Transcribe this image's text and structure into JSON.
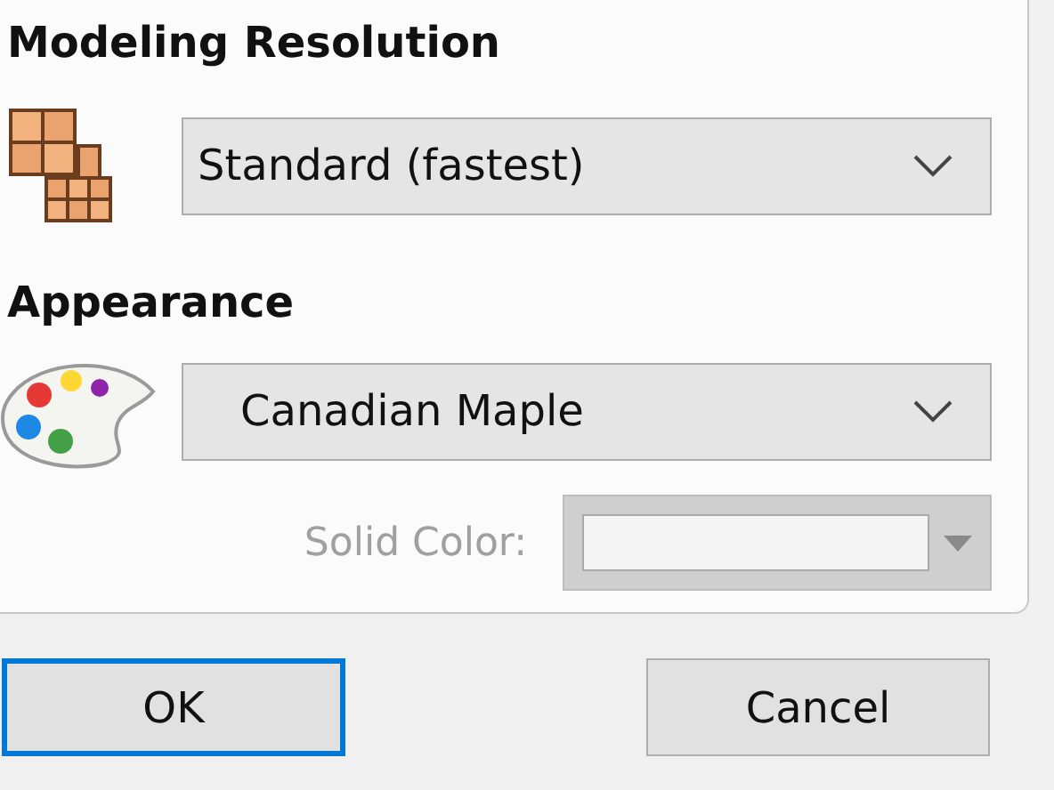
{
  "modeling_resolution": {
    "label": "Modeling Resolution",
    "value": "Standard (fastest)"
  },
  "appearance": {
    "label": "Appearance",
    "value": "Canadian Maple",
    "solid_color": {
      "label": "Solid Color:",
      "disabled": true
    }
  },
  "buttons": [
    {
      "label": "OK",
      "default": true
    },
    {
      "label": "Cancel",
      "default": false
    }
  ]
}
